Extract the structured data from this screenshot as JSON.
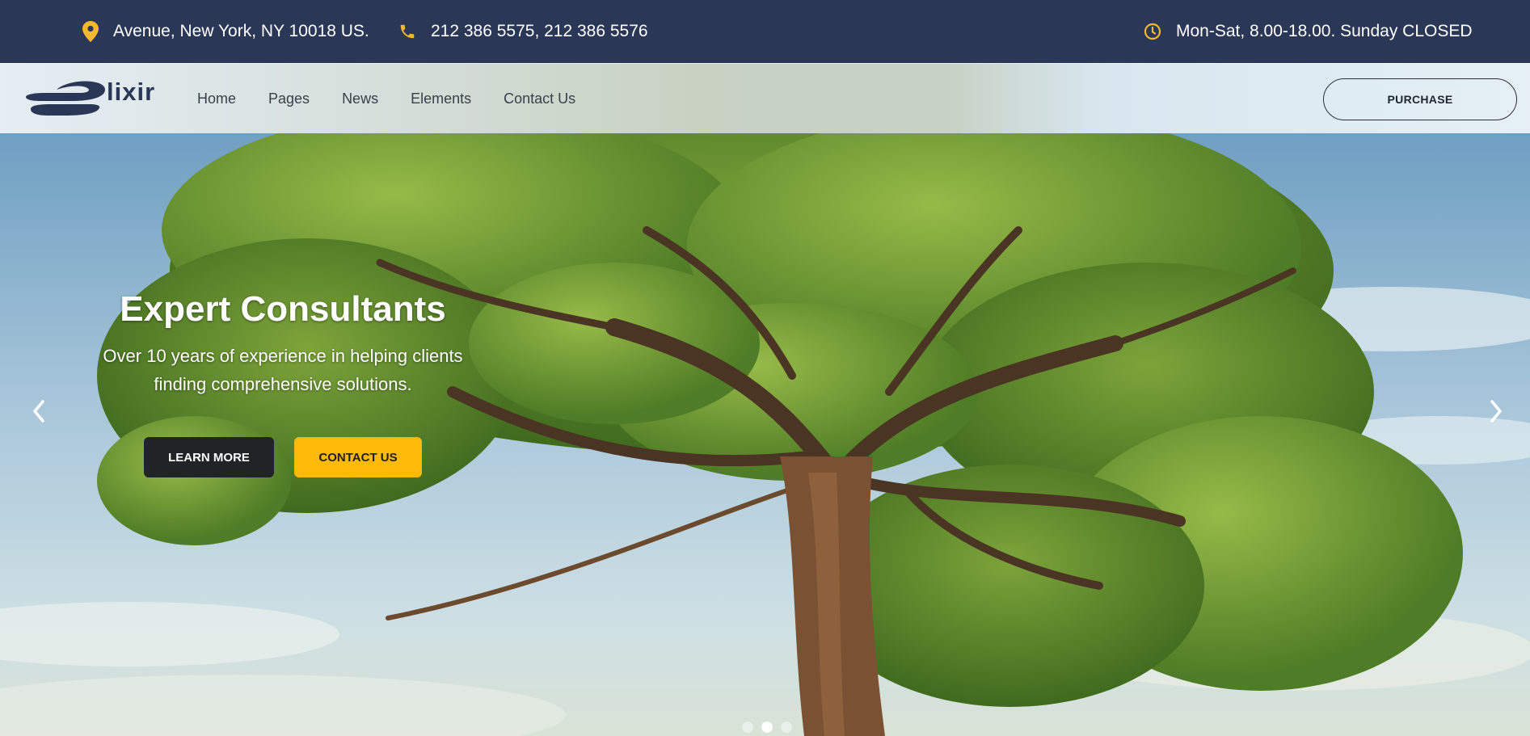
{
  "topbar": {
    "address": "Avenue, New York, NY 10018 US.",
    "phone": "212 386 5575, 212 386 5576",
    "hours": "Mon-Sat, 8.00-18.00. Sunday CLOSED",
    "icons": [
      "map-pin-icon",
      "phone-icon",
      "clock-icon"
    ],
    "icon_color": "#f5b82e",
    "background": "#2b3756"
  },
  "header": {
    "logo_text": "lixir",
    "nav": [
      "Home",
      "Pages",
      "News",
      "Elements",
      "Contact Us"
    ],
    "purchase_label": "PURCHASE"
  },
  "hero": {
    "title": "Expert Consultants",
    "subtitle": "Over 10 years of experience in helping clients finding comprehensive solutions.",
    "learn_more_label": "LEARN MORE",
    "contact_label": "CONTACT US",
    "slides": 3,
    "active_slide": 2,
    "accent": "#ffba08"
  }
}
